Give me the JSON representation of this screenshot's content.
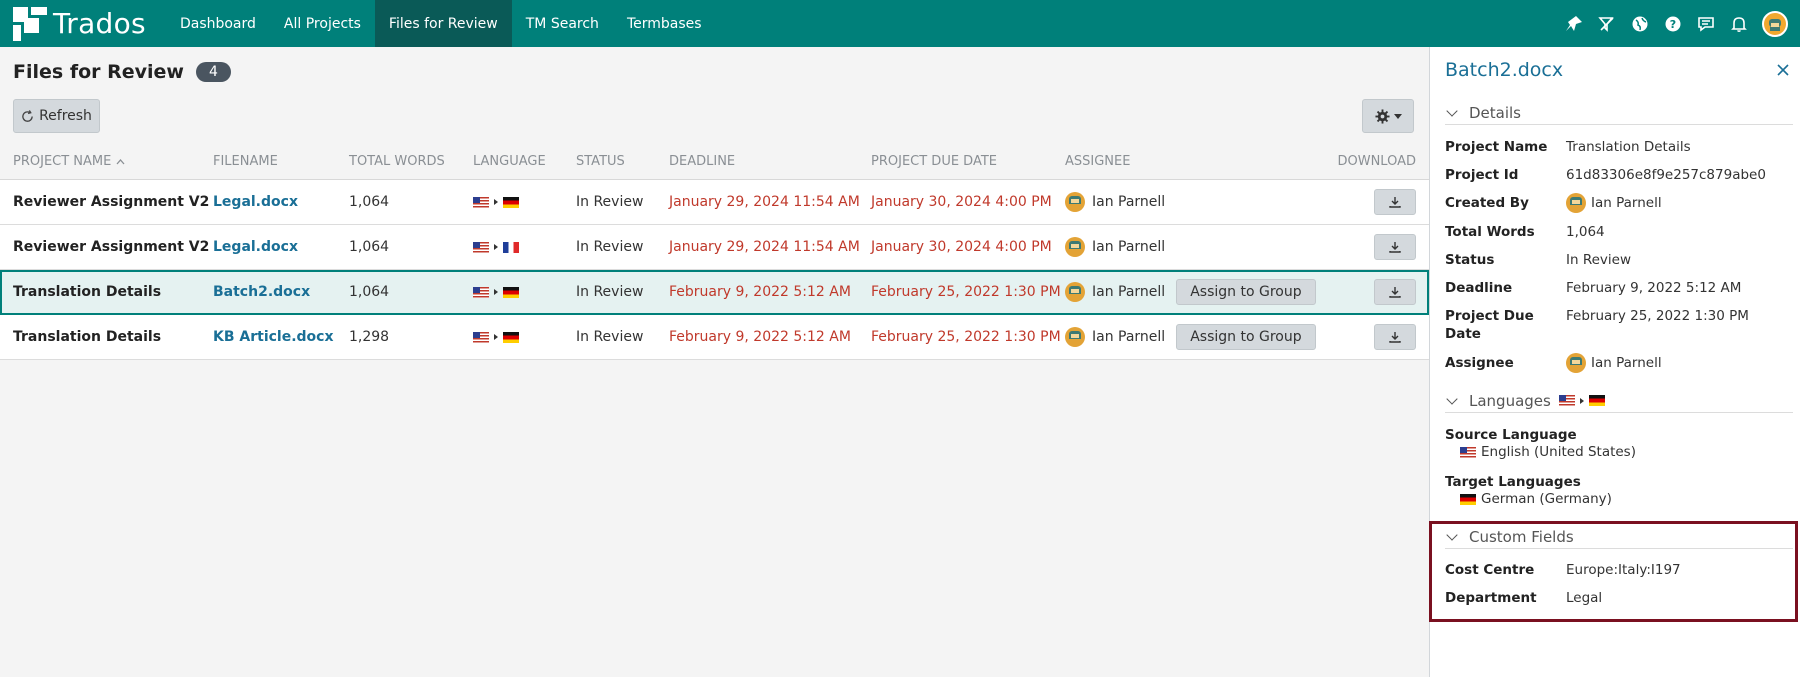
{
  "app": {
    "name": "Trados"
  },
  "nav": {
    "tabs": [
      {
        "label": "Dashboard",
        "active": false
      },
      {
        "label": "All Projects",
        "active": false
      },
      {
        "label": "Files for Review",
        "active": true
      },
      {
        "label": "TM Search",
        "active": false
      },
      {
        "label": "Termbases",
        "active": false
      }
    ],
    "icons": [
      "pin-icon",
      "filter-icon",
      "globe-icon",
      "help-icon",
      "chat-icon",
      "bell-icon",
      "user-avatar"
    ]
  },
  "page": {
    "title": "Files for Review",
    "count": "4",
    "refresh_label": "Refresh"
  },
  "table": {
    "columns": {
      "project": "PROJECT NAME",
      "file": "FILENAME",
      "words": "TOTAL WORDS",
      "language": "LANGUAGE",
      "status": "STATUS",
      "deadline": "DEADLINE",
      "due": "PROJECT DUE DATE",
      "assignee": "ASSIGNEE",
      "download": "DOWNLOAD"
    },
    "rows": [
      {
        "project": "Reviewer Assignment V2",
        "file": "Legal.docx",
        "words": "1,064",
        "source": "us",
        "target": "de",
        "status": "In Review",
        "deadline": "January 29, 2024 11:54 AM",
        "due": "January 30, 2024 4:00 PM",
        "assignee": "Ian Parnell",
        "assign_group": ""
      },
      {
        "project": "Reviewer Assignment V2",
        "file": "Legal.docx",
        "words": "1,064",
        "source": "us",
        "target": "fr",
        "status": "In Review",
        "deadline": "January 29, 2024 11:54 AM",
        "due": "January 30, 2024 4:00 PM",
        "assignee": "Ian Parnell",
        "assign_group": ""
      },
      {
        "project": "Translation Details",
        "file": "Batch2.docx",
        "words": "1,064",
        "source": "us",
        "target": "de",
        "status": "In Review",
        "deadline": "February 9, 2022 5:12 AM",
        "due": "February 25, 2022 1:30 PM",
        "assignee": "Ian Parnell",
        "assign_group": "Assign to Group",
        "selected": true
      },
      {
        "project": "Translation Details",
        "file": "KB Article.docx",
        "words": "1,298",
        "source": "us",
        "target": "de",
        "status": "In Review",
        "deadline": "February 9, 2022 5:12 AM",
        "due": "February 25, 2022 1:30 PM",
        "assignee": "Ian Parnell",
        "assign_group": "Assign to Group"
      }
    ]
  },
  "panel": {
    "title": "Batch2.docx",
    "details_heading": "Details",
    "details": {
      "project_name_label": "Project Name",
      "project_name": "Translation Details",
      "project_id_label": "Project Id",
      "project_id": "61d83306e8f9e257c879abe0",
      "created_by_label": "Created By",
      "created_by": "Ian Parnell",
      "total_words_label": "Total Words",
      "total_words": "1,064",
      "status_label": "Status",
      "status": "In Review",
      "deadline_label": "Deadline",
      "deadline": "February 9, 2022 5:12 AM",
      "due_label": "Project Due Date",
      "due": "February 25, 2022 1:30 PM",
      "assignee_label": "Assignee",
      "assignee": "Ian Parnell"
    },
    "languages_heading": "Languages",
    "source_language_label": "Source Language",
    "source_language": "English (United States)",
    "target_languages_label": "Target Languages",
    "target_language": "German (Germany)",
    "custom_fields_heading": "Custom Fields",
    "custom_fields": {
      "cost_centre_label": "Cost Centre",
      "cost_centre": "Europe:Italy:I197",
      "department_label": "Department",
      "department": "Legal"
    }
  },
  "colors": {
    "brand": "#00807a",
    "link": "#1a6f96",
    "date": "#c0392b",
    "highlight": "#7a1020"
  }
}
